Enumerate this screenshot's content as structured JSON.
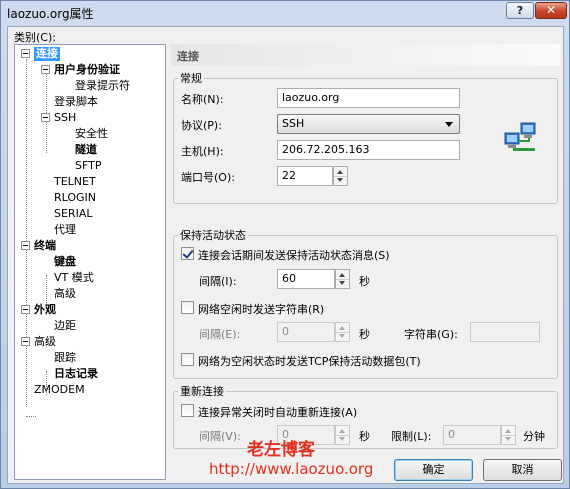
{
  "window": {
    "title": "laozuo.org属性",
    "help_label": "?",
    "close_label": "✕"
  },
  "category_label": "类别(C):",
  "tree": [
    {
      "label": "连接",
      "bold": true,
      "selected": true
    },
    {
      "label": "用户身份验证",
      "bold": true
    },
    {
      "label": "登录提示符"
    },
    {
      "label": "登录脚本"
    },
    {
      "label": "SSH"
    },
    {
      "label": "安全性"
    },
    {
      "label": "隧道",
      "bold": true
    },
    {
      "label": "SFTP"
    },
    {
      "label": "TELNET"
    },
    {
      "label": "RLOGIN"
    },
    {
      "label": "SERIAL"
    },
    {
      "label": "代理"
    },
    {
      "label": "终端",
      "bold": true
    },
    {
      "label": "键盘",
      "bold": true
    },
    {
      "label": "VT 模式"
    },
    {
      "label": "高级"
    },
    {
      "label": "外观",
      "bold": true
    },
    {
      "label": "边距"
    },
    {
      "label": "高级"
    },
    {
      "label": "跟踪"
    },
    {
      "label": "日志记录",
      "bold": true
    },
    {
      "label": "ZMODEM"
    }
  ],
  "panel": {
    "title": "连接",
    "general": {
      "legend": "常规",
      "name_label": "名称(N):",
      "name_value": "laozuo.org",
      "protocol_label": "协议(P):",
      "protocol_value": "SSH",
      "host_label": "主机(H):",
      "host_value": "206.72.205.163",
      "port_label": "端口号(O):",
      "port_value": "22",
      "icon": "network-computers-icon"
    },
    "keepalive": {
      "legend": "保持活动状态",
      "send_msg_label": "连接会话期间发送保持活动状态消息(S)",
      "send_msg_checked": true,
      "interval1_label": "间隔(I):",
      "interval1_value": "60",
      "sec1_label": "秒",
      "send_str_label": "网络空闲时发送字符串(R)",
      "send_str_checked": false,
      "interval2_label": "间隔(E):",
      "interval2_value": "0",
      "sec2_label": "秒",
      "string_label": "字符串(G):",
      "string_value": "",
      "tcp_label": "网络为空闲状态时发送TCP保持活动数据包(T)",
      "tcp_checked": false
    },
    "reconnect": {
      "legend": "重新连接",
      "auto_label": "连接异常关闭时自动重新连接(A)",
      "auto_checked": false,
      "interval_label": "间隔(V):",
      "interval_value": "0",
      "sec_label": "秒",
      "limit_label": "限制(L):",
      "limit_value": "0",
      "min_label": "分钟"
    }
  },
  "buttons": {
    "ok": "确定",
    "cancel": "取消"
  },
  "watermark": {
    "name": "老左博客",
    "url": "http://www.laozuo.org"
  }
}
